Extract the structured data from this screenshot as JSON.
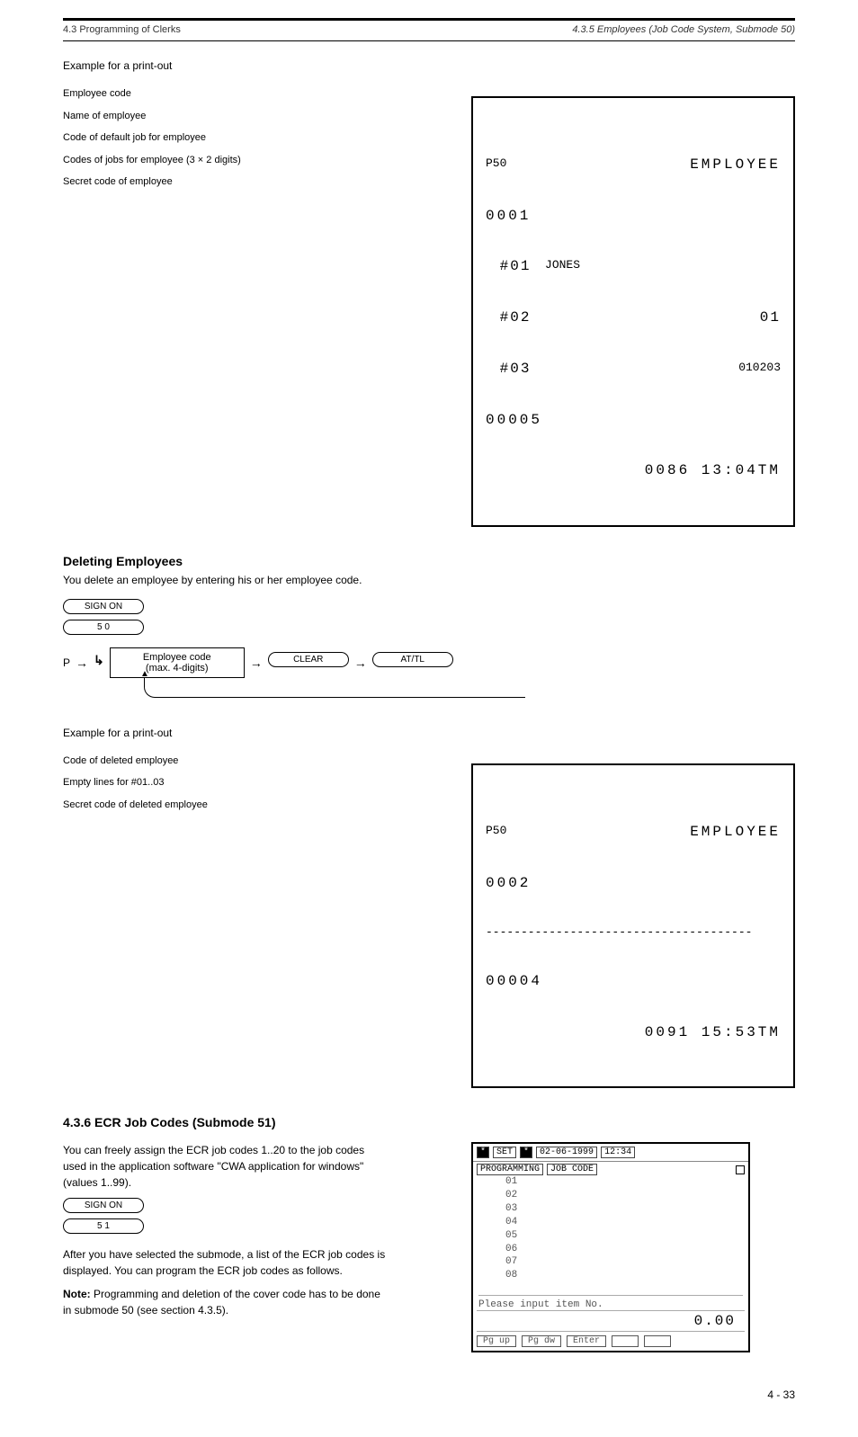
{
  "header": {
    "left": "4.3  Programming of Clerks",
    "right": "4.3.5  Employees (Job Code System, Submode 50)"
  },
  "receipt_a": {
    "title_line": {
      "left": "P50",
      "mid": "EMPLOYEE"
    },
    "code": "0001",
    "rows": [
      {
        "idx": "#01",
        "name": "JONES",
        "right": ""
      },
      {
        "idx": "#02",
        "name": "",
        "right": "01"
      },
      {
        "idx": "#03",
        "name": "",
        "right": "010203"
      }
    ],
    "trailer_code": "00005",
    "footer": "0086 13:04TM",
    "annos": [
      "Employee code",
      "Name of employee",
      "Code of default job for employee",
      "Codes of jobs for employee (3 × 2 digits)",
      "Secret code of employee"
    ]
  },
  "sect_delete": {
    "title": "Deleting Employees",
    "sub": "You delete an employee by entering his or her employee code.",
    "keys": {
      "k1": "SIGN ON",
      "k2": "5 0"
    },
    "proc": {
      "start": "P",
      "step1": "Employee code\n(max. 4-digits)",
      "end": "AT/TL",
      "end_key": "CLEAR"
    }
  },
  "receipt_b": {
    "title_line": {
      "left": "P50",
      "mid": "EMPLOYEE"
    },
    "code": "0002",
    "dash": "--------------------------------------",
    "trailer_code": "00004",
    "footer": "0091 15:53TM",
    "annos": [
      "Code of deleted employee",
      "Empty lines for #01..03",
      "Secret code of deleted employee"
    ]
  },
  "sect_51": {
    "title": "4.3.6 ECR Job Codes (Submode 51)",
    "para1": "You can freely assign the ECR job codes 1..20 to the job codes used in the application software \"CWA application for windows\" (values 1..99).",
    "keys": {
      "k1": "SIGN ON",
      "k2": "5 1"
    },
    "para2": "After you have selected the submode, a list of the ECR job codes is displayed. You can program the ECR job codes as follows.",
    "note_label": "Note:",
    "note": "Programming and deletion of the cover code has to be done in submode 50 (see section 4.3.5).",
    "screen": {
      "top": {
        "set": "SET",
        "bullet": "*",
        "date": "02-06-1999",
        "time": "12:34"
      },
      "crumbs": {
        "a": "PROGRAMMING",
        "b": "JOB CODE"
      },
      "rows": [
        "01",
        "02",
        "03",
        "04",
        "05",
        "06",
        "07",
        "08"
      ],
      "prompt": "Please input item No.",
      "value": "0.00",
      "soft": [
        "Pg up",
        "Pg dw",
        "Enter"
      ]
    }
  },
  "footer_page": "4 - 33"
}
